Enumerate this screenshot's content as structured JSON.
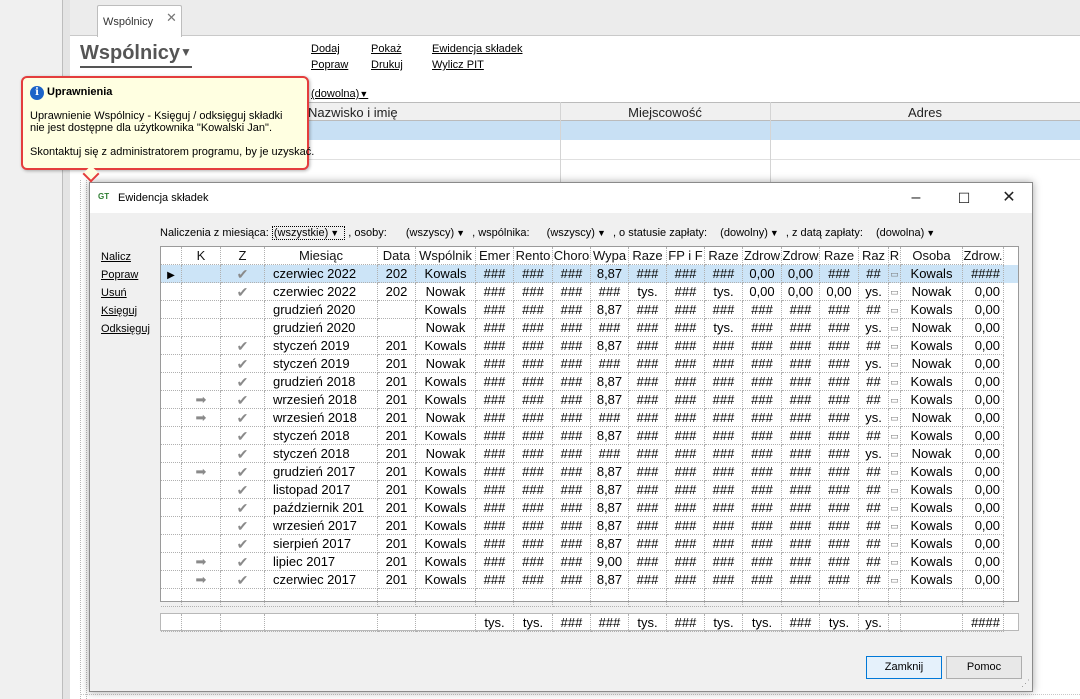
{
  "tab": {
    "label": "Wspólnicy",
    "close": "✕"
  },
  "page": {
    "title": "Wspólnicy",
    "links": {
      "dodaj": "Dodaj",
      "popraw": "Popraw",
      "pokaz": "Pokaż",
      "drukuj": "Drukuj",
      "ewidencja": "Ewidencja składek",
      "wylicz_pit": "Wylicz PIT"
    },
    "filter_value": "(dowolna)",
    "bg_columns": [
      "Nazwisko i imię",
      "Miejscowość",
      "Adres"
    ]
  },
  "tooltip": {
    "title": "Uprawnienia",
    "line1": "Uprawnienie Wspólnicy - Księguj / odksięguj składki",
    "line2": "nie jest dostępne dla użytkownika \"Kowalski Jan\".",
    "line3": "Skontaktuj się z administratorem programu, by je uzyskać."
  },
  "dialog": {
    "title": "Ewidencja składek",
    "filters": {
      "month_label": "Naliczenia z miesiąca:",
      "month_value": "(wszystkie)",
      "persons_label": ", osoby:",
      "persons_value": "(wszyscy)",
      "partner_label": ", wspólnika:",
      "partner_value": "(wszyscy)",
      "status_label": ", o statusie zapłaty:",
      "status_value": "(dowolny)",
      "date_label": ", z datą zapłaty:",
      "date_value": "(dowolna)"
    },
    "side_actions": [
      "Nalicz",
      "Popraw",
      "Usuń",
      "Księguj",
      "Odksięguj"
    ],
    "columns": [
      "K",
      "Z",
      "Miesiąc",
      "Data",
      "Wspólnik",
      "Emer",
      "Rento",
      "Choro",
      "Wypa",
      "Raze",
      "FP i F",
      "Raze",
      "Zdrow",
      "Zdrow",
      "Raze",
      "Raz",
      "R",
      "Osoba",
      "Zdrow."
    ],
    "rows": [
      {
        "k": "",
        "z": "✔",
        "miesiac": "czerwiec 2022",
        "data": "202",
        "wspolnik": "Kowals",
        "emer": "###",
        "rento": "###",
        "choro": "###",
        "wypa": "8,87",
        "raze1": "###",
        "fp": "###",
        "raze2": "###",
        "zdrow1": "0,00",
        "zdrow2": "0,00",
        "raze3": "###",
        "raz": "##",
        "r": "▭",
        "osoba": "Kowals",
        "zdrow3": "####",
        "selected": true
      },
      {
        "k": "",
        "z": "✔",
        "miesiac": "czerwiec 2022",
        "data": "202",
        "wspolnik": "Nowak",
        "emer": "###",
        "rento": "###",
        "choro": "###",
        "wypa": "###",
        "raze1": "tys.",
        "fp": "###",
        "raze2": "tys.",
        "zdrow1": "0,00",
        "zdrow2": "0,00",
        "raze3": "0,00",
        "raz": "ys.",
        "r": "▭",
        "osoba": "Nowak",
        "zdrow3": "0,00"
      },
      {
        "k": "",
        "z": "",
        "miesiac": "grudzień 2020",
        "data": "",
        "wspolnik": "Kowals",
        "emer": "###",
        "rento": "###",
        "choro": "###",
        "wypa": "8,87",
        "raze1": "###",
        "fp": "###",
        "raze2": "###",
        "zdrow1": "###",
        "zdrow2": "###",
        "raze3": "###",
        "raz": "##",
        "r": "▭",
        "osoba": "Kowals",
        "zdrow3": "0,00"
      },
      {
        "k": "",
        "z": "",
        "miesiac": "grudzień 2020",
        "data": "",
        "wspolnik": "Nowak",
        "emer": "###",
        "rento": "###",
        "choro": "###",
        "wypa": "###",
        "raze1": "###",
        "fp": "###",
        "raze2": "tys.",
        "zdrow1": "###",
        "zdrow2": "###",
        "raze3": "###",
        "raz": "ys.",
        "r": "▭",
        "osoba": "Nowak",
        "zdrow3": "0,00"
      },
      {
        "k": "",
        "z": "✔",
        "miesiac": "styczeń 2019",
        "data": "201",
        "wspolnik": "Kowals",
        "emer": "###",
        "rento": "###",
        "choro": "###",
        "wypa": "8,87",
        "raze1": "###",
        "fp": "###",
        "raze2": "###",
        "zdrow1": "###",
        "zdrow2": "###",
        "raze3": "###",
        "raz": "##",
        "r": "▭",
        "osoba": "Kowals",
        "zdrow3": "0,00"
      },
      {
        "k": "",
        "z": "✔",
        "miesiac": "styczeń 2019",
        "data": "201",
        "wspolnik": "Nowak",
        "emer": "###",
        "rento": "###",
        "choro": "###",
        "wypa": "###",
        "raze1": "###",
        "fp": "###",
        "raze2": "###",
        "zdrow1": "###",
        "zdrow2": "###",
        "raze3": "###",
        "raz": "ys.",
        "r": "▭",
        "osoba": "Nowak",
        "zdrow3": "0,00"
      },
      {
        "k": "",
        "z": "✔",
        "miesiac": "grudzień 2018",
        "data": "201",
        "wspolnik": "Kowals",
        "emer": "###",
        "rento": "###",
        "choro": "###",
        "wypa": "8,87",
        "raze1": "###",
        "fp": "###",
        "raze2": "###",
        "zdrow1": "###",
        "zdrow2": "###",
        "raze3": "###",
        "raz": "##",
        "r": "▭",
        "osoba": "Kowals",
        "zdrow3": "0,00"
      },
      {
        "k": "➡",
        "z": "✔",
        "miesiac": "wrzesień 2018",
        "data": "201",
        "wspolnik": "Kowals",
        "emer": "###",
        "rento": "###",
        "choro": "###",
        "wypa": "8,87",
        "raze1": "###",
        "fp": "###",
        "raze2": "###",
        "zdrow1": "###",
        "zdrow2": "###",
        "raze3": "###",
        "raz": "##",
        "r": "▭",
        "osoba": "Kowals",
        "zdrow3": "0,00"
      },
      {
        "k": "➡",
        "z": "✔",
        "miesiac": "wrzesień 2018",
        "data": "201",
        "wspolnik": "Nowak",
        "emer": "###",
        "rento": "###",
        "choro": "###",
        "wypa": "###",
        "raze1": "###",
        "fp": "###",
        "raze2": "###",
        "zdrow1": "###",
        "zdrow2": "###",
        "raze3": "###",
        "raz": "ys.",
        "r": "▭",
        "osoba": "Nowak",
        "zdrow3": "0,00"
      },
      {
        "k": "",
        "z": "✔",
        "miesiac": "styczeń 2018",
        "data": "201",
        "wspolnik": "Kowals",
        "emer": "###",
        "rento": "###",
        "choro": "###",
        "wypa": "8,87",
        "raze1": "###",
        "fp": "###",
        "raze2": "###",
        "zdrow1": "###",
        "zdrow2": "###",
        "raze3": "###",
        "raz": "##",
        "r": "▭",
        "osoba": "Kowals",
        "zdrow3": "0,00"
      },
      {
        "k": "",
        "z": "✔",
        "miesiac": "styczeń 2018",
        "data": "201",
        "wspolnik": "Nowak",
        "emer": "###",
        "rento": "###",
        "choro": "###",
        "wypa": "###",
        "raze1": "###",
        "fp": "###",
        "raze2": "###",
        "zdrow1": "###",
        "zdrow2": "###",
        "raze3": "###",
        "raz": "ys.",
        "r": "▭",
        "osoba": "Nowak",
        "zdrow3": "0,00"
      },
      {
        "k": "➡",
        "z": "✔",
        "miesiac": "grudzień 2017",
        "data": "201",
        "wspolnik": "Kowals",
        "emer": "###",
        "rento": "###",
        "choro": "###",
        "wypa": "8,87",
        "raze1": "###",
        "fp": "###",
        "raze2": "###",
        "zdrow1": "###",
        "zdrow2": "###",
        "raze3": "###",
        "raz": "##",
        "r": "▭",
        "osoba": "Kowals",
        "zdrow3": "0,00"
      },
      {
        "k": "",
        "z": "✔",
        "miesiac": "listopad 2017",
        "data": "201",
        "wspolnik": "Kowals",
        "emer": "###",
        "rento": "###",
        "choro": "###",
        "wypa": "8,87",
        "raze1": "###",
        "fp": "###",
        "raze2": "###",
        "zdrow1": "###",
        "zdrow2": "###",
        "raze3": "###",
        "raz": "##",
        "r": "▭",
        "osoba": "Kowals",
        "zdrow3": "0,00"
      },
      {
        "k": "",
        "z": "✔",
        "miesiac": "październik 201",
        "data": "201",
        "wspolnik": "Kowals",
        "emer": "###",
        "rento": "###",
        "choro": "###",
        "wypa": "8,87",
        "raze1": "###",
        "fp": "###",
        "raze2": "###",
        "zdrow1": "###",
        "zdrow2": "###",
        "raze3": "###",
        "raz": "##",
        "r": "▭",
        "osoba": "Kowals",
        "zdrow3": "0,00"
      },
      {
        "k": "",
        "z": "✔",
        "miesiac": "wrzesień 2017",
        "data": "201",
        "wspolnik": "Kowals",
        "emer": "###",
        "rento": "###",
        "choro": "###",
        "wypa": "8,87",
        "raze1": "###",
        "fp": "###",
        "raze2": "###",
        "zdrow1": "###",
        "zdrow2": "###",
        "raze3": "###",
        "raz": "##",
        "r": "▭",
        "osoba": "Kowals",
        "zdrow3": "0,00"
      },
      {
        "k": "",
        "z": "✔",
        "miesiac": "sierpień 2017",
        "data": "201",
        "wspolnik": "Kowals",
        "emer": "###",
        "rento": "###",
        "choro": "###",
        "wypa": "8,87",
        "raze1": "###",
        "fp": "###",
        "raze2": "###",
        "zdrow1": "###",
        "zdrow2": "###",
        "raze3": "###",
        "raz": "##",
        "r": "▭",
        "osoba": "Kowals",
        "zdrow3": "0,00"
      },
      {
        "k": "➡",
        "z": "✔",
        "miesiac": "lipiec 2017",
        "data": "201",
        "wspolnik": "Kowals",
        "emer": "###",
        "rento": "###",
        "choro": "###",
        "wypa": "9,00",
        "raze1": "###",
        "fp": "###",
        "raze2": "###",
        "zdrow1": "###",
        "zdrow2": "###",
        "raze3": "###",
        "raz": "##",
        "r": "▭",
        "osoba": "Kowals",
        "zdrow3": "0,00"
      },
      {
        "k": "➡",
        "z": "✔",
        "miesiac": "czerwiec 2017",
        "data": "201",
        "wspolnik": "Kowals",
        "emer": "###",
        "rento": "###",
        "choro": "###",
        "wypa": "8,87",
        "raze1": "###",
        "fp": "###",
        "raze2": "###",
        "zdrow1": "###",
        "zdrow2": "###",
        "raze3": "###",
        "raz": "##",
        "r": "▭",
        "osoba": "Kowals",
        "zdrow3": "0,00"
      }
    ],
    "summary": [
      "",
      "",
      "",
      "",
      "",
      "tys.",
      "tys.",
      "###",
      "###",
      "tys.",
      "###",
      "tys.",
      "tys.",
      "###",
      "tys.",
      "ys.",
      "",
      "",
      "####"
    ],
    "buttons": {
      "close": "Zamknij",
      "help": "Pomoc"
    }
  }
}
